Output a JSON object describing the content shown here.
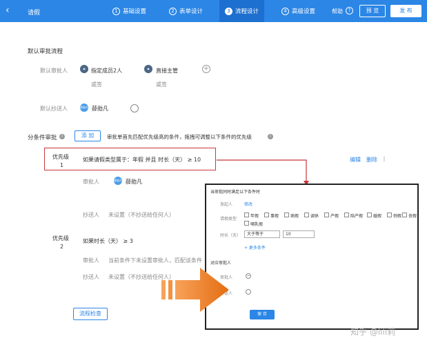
{
  "header": {
    "back_icon": "chevron-left-icon",
    "title": "请假",
    "steps": [
      {
        "num": "1",
        "label": "基础设置"
      },
      {
        "num": "2",
        "label": "表单设计"
      },
      {
        "num": "3",
        "label": "流程设计"
      },
      {
        "num": "4",
        "label": "高级设置"
      }
    ],
    "active_step": 3,
    "help": "帮助",
    "help_icon": "?",
    "preview": "预 览",
    "publish": "发 布",
    "bar_color": "#2b86e6"
  },
  "default_flow": {
    "title": "默认审批流程",
    "approver_label": "默认审批人",
    "approvers": [
      {
        "name": "指定成员2人",
        "sub": "或签"
      },
      {
        "name": "直接主管",
        "sub": "或签"
      }
    ],
    "add_icon": "+",
    "cc_label": "默认抄送人",
    "cc_avatar": "薛勋凡",
    "cc_name": "薛勋凡"
  },
  "conditional": {
    "title": "分条件审批",
    "info_icon": "i",
    "add_button": "添 加",
    "hint": "审批单首先匹配优先级高的条件，拖拽可调整以下条件的优先级",
    "rules": [
      {
        "priority_label": "优先级",
        "priority_num": "1",
        "condition": "如果请假类型属于：年假 并且 时长（天） ≥ 10",
        "approver_label": "审批人",
        "approver_avatar": "薛勋凡",
        "approver_name": "薛勋凡",
        "cc_label": "抄送人",
        "cc_value": "未设置（不抄送给任何人）",
        "actions": {
          "edit": "编辑",
          "delete": "删除",
          "more": "⋮"
        }
      },
      {
        "priority_label": "优先级",
        "priority_num": "2",
        "condition": "如果时长（天） ≥ 3",
        "approver_label": "审批人",
        "approver_value": "当前条件下未设置审批人，匹配该条件",
        "cc_label": "抄送人",
        "cc_value": "未设置（不抄送给任何人）"
      }
    ],
    "check_button": "流程检查"
  },
  "panel": {
    "title": "当审批同时满足以下条件时",
    "initiator_label": "发起人",
    "initiator_value": "修改",
    "leave_type_label": "请假类型",
    "leave_types": [
      "年假",
      "事假",
      "病假",
      "调休",
      "产假",
      "陪产假",
      "婚假",
      "例假",
      "丧假",
      "哺乳假"
    ],
    "duration_label": "时长（天）",
    "operator": "大于等于",
    "duration_value": "10",
    "add_condition": "+ 更多条件",
    "approver_section": "对应审批人",
    "approver_label": "审批人",
    "cc_label": "抄送人",
    "save": "保 存"
  },
  "watermark": "知乎 @lili莉",
  "colors": {
    "accent": "#2b86e6",
    "highlight": "#c8353a",
    "arrow": "#f07b1e"
  }
}
